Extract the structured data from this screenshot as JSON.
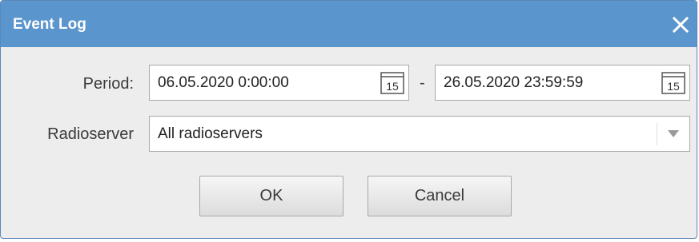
{
  "window": {
    "title": "Event Log",
    "titlebar_color": "#5b95cd",
    "close_icon": "close-icon"
  },
  "period": {
    "label": "Period:",
    "from_value": "06.05.2020 0:00:00",
    "separator": "-",
    "to_value": "26.05.2020 23:59:59",
    "calendar_icon": "calendar-icon",
    "calendar_day": "15"
  },
  "radioserver": {
    "label": "Radioserver",
    "selected": "All radioservers",
    "dropdown_icon": "chevron-down-icon"
  },
  "buttons": {
    "ok_label": "OK",
    "cancel_label": "Cancel"
  }
}
